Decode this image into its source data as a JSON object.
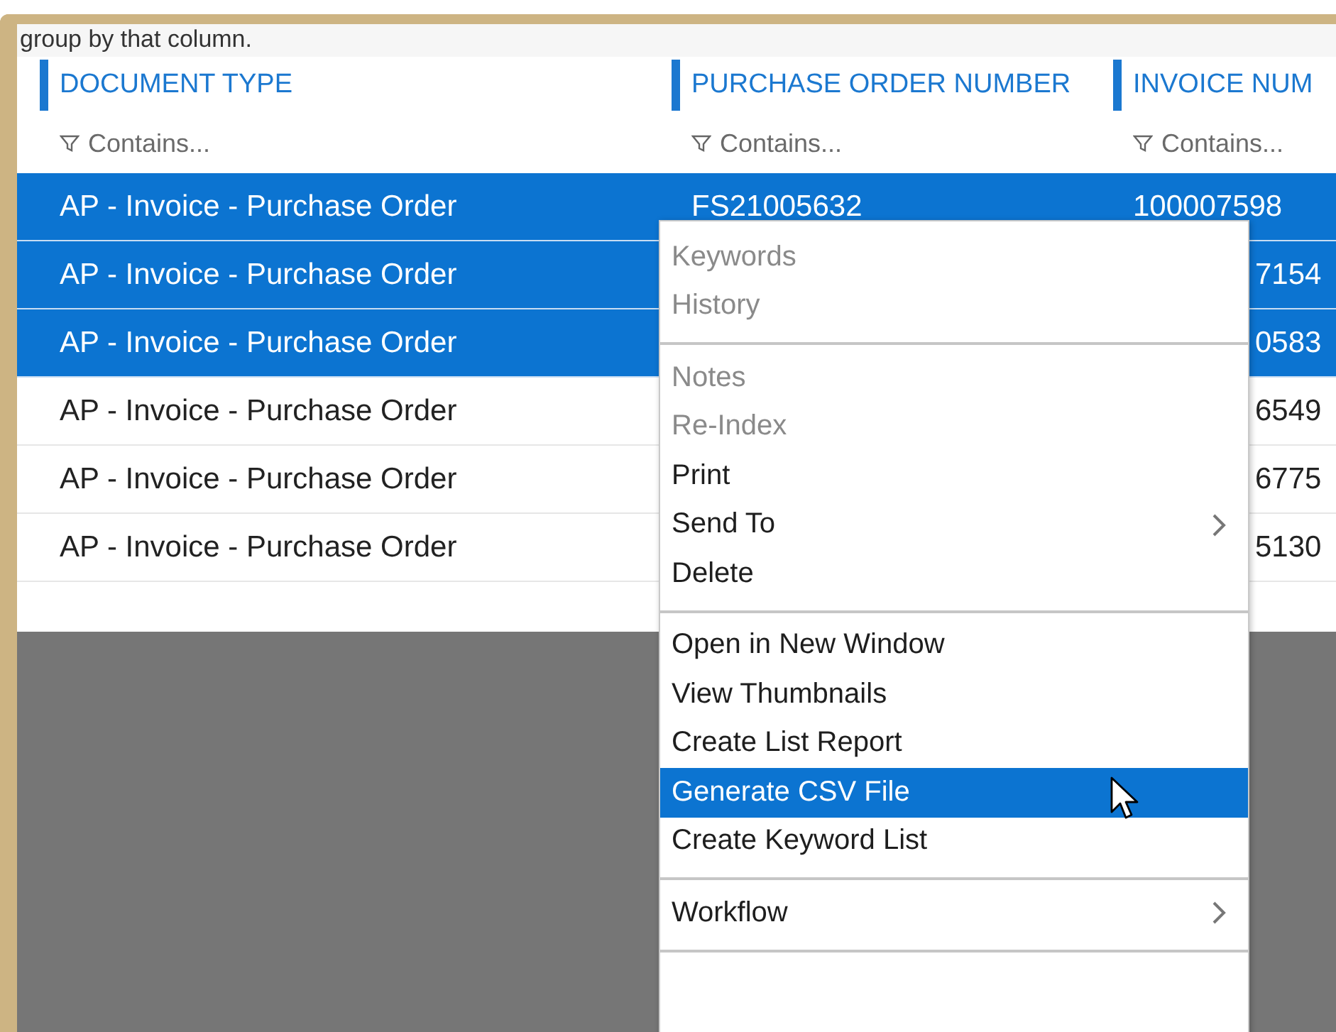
{
  "hint": "group by that column.",
  "columns": [
    {
      "label": "DOCUMENT TYPE",
      "placeholder": "Contains..."
    },
    {
      "label": "PURCHASE ORDER NUMBER",
      "placeholder": "Contains..."
    },
    {
      "label": "INVOICE NUM",
      "placeholder": "Contains..."
    }
  ],
  "rows": [
    {
      "selected": true,
      "document_type": "AP - Invoice - Purchase Order",
      "po_number": "FS21005632",
      "invoice_number": "100007598",
      "invoice_covered": false
    },
    {
      "selected": true,
      "document_type": "AP - Invoice - Purchase Order",
      "invoice_number": "7154",
      "invoice_covered": true
    },
    {
      "selected": true,
      "document_type": "AP - Invoice - Purchase Order",
      "invoice_number": "0583",
      "invoice_covered": true
    },
    {
      "selected": false,
      "document_type": "AP - Invoice - Purchase Order",
      "invoice_number": "6549",
      "invoice_covered": true
    },
    {
      "selected": false,
      "document_type": "AP - Invoice - Purchase Order",
      "invoice_number": "6775",
      "invoice_covered": true
    },
    {
      "selected": false,
      "document_type": "AP - Invoice - Purchase Order",
      "invoice_number": "5130",
      "invoice_covered": true
    }
  ],
  "context_menu": {
    "sections": [
      [
        {
          "label": "Keywords",
          "disabled": true,
          "selected": false,
          "submenu": false
        },
        {
          "label": "History",
          "disabled": true,
          "selected": false,
          "submenu": false
        }
      ],
      [
        {
          "label": "Notes",
          "disabled": true,
          "selected": false,
          "submenu": false
        },
        {
          "label": "Re-Index",
          "disabled": true,
          "selected": false,
          "submenu": false
        },
        {
          "label": "Print",
          "disabled": false,
          "selected": false,
          "submenu": false
        },
        {
          "label": "Send To",
          "disabled": false,
          "selected": false,
          "submenu": true
        },
        {
          "label": "Delete",
          "disabled": false,
          "selected": false,
          "submenu": false
        }
      ],
      [
        {
          "label": "Open in New Window",
          "disabled": false,
          "selected": false,
          "submenu": false
        },
        {
          "label": "View Thumbnails",
          "disabled": false,
          "selected": false,
          "submenu": false
        },
        {
          "label": "Create List Report",
          "disabled": false,
          "selected": false,
          "submenu": false
        },
        {
          "label": "Generate CSV File",
          "disabled": false,
          "selected": true,
          "submenu": false
        },
        {
          "label": "Create Keyword List",
          "disabled": false,
          "selected": false,
          "submenu": false
        }
      ],
      [
        {
          "label": "Workflow",
          "disabled": false,
          "selected": false,
          "submenu": true
        }
      ]
    ]
  }
}
